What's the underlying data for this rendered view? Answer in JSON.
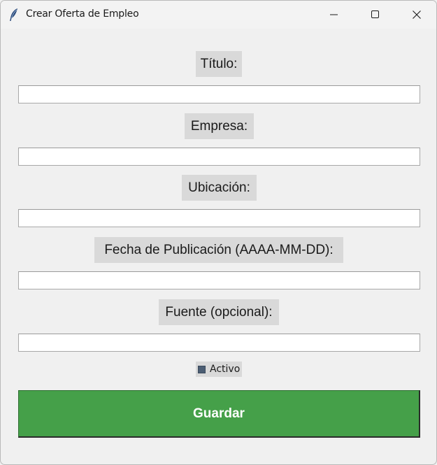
{
  "window": {
    "title": "Crear Oferta de Empleo",
    "controls": {
      "minimize": "minimize-icon",
      "maximize": "maximize-icon",
      "close": "close-icon"
    }
  },
  "form": {
    "titulo": {
      "label": "Título:",
      "value": "",
      "placeholder": ""
    },
    "empresa": {
      "label": "Empresa:",
      "value": "",
      "placeholder": ""
    },
    "ubicacion": {
      "label": "Ubicación:",
      "value": "",
      "placeholder": ""
    },
    "fecha": {
      "label": "Fecha de Publicación (AAAA-MM-DD):",
      "value": "",
      "placeholder": ""
    },
    "fuente": {
      "label": "Fuente (opcional):",
      "value": "",
      "placeholder": ""
    },
    "activo": {
      "label": "Activo",
      "checked": true
    },
    "save_label": "Guardar"
  },
  "colors": {
    "save_button": "#45a049",
    "label_bg": "#d9d9d9",
    "window_bg": "#f0f0f0"
  }
}
